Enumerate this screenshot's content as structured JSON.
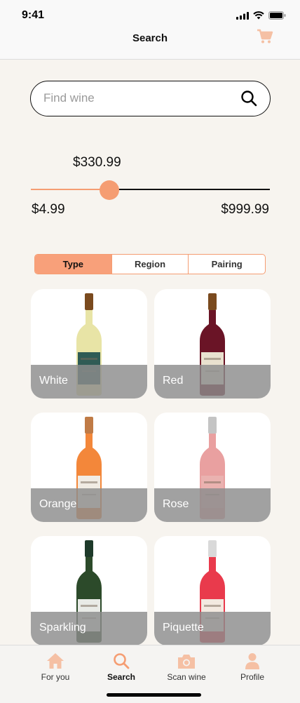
{
  "status": {
    "time": "9:41"
  },
  "nav": {
    "title": "Search"
  },
  "search": {
    "placeholder": "Find wine",
    "value": ""
  },
  "price": {
    "current": "$330.99",
    "min": "$4.99",
    "max": "$999.99",
    "fraction": 0.327
  },
  "filters": {
    "tabs": [
      "Type",
      "Region",
      "Pairing"
    ],
    "active": "Type"
  },
  "wine_types": [
    {
      "label": "White",
      "color": "#e8e4a6",
      "label_color": "#2f5b55",
      "cap": "#7a4a1e"
    },
    {
      "label": "Red",
      "color": "#6a1426",
      "label_color": "#e9e1cf",
      "cap": "#7a4a1e"
    },
    {
      "label": "Orange",
      "color": "#f3873a",
      "label_color": "#f1ece4",
      "cap": "#c07b46"
    },
    {
      "label": "Rose",
      "color": "#e9a0a0",
      "label_color": "#eab2b0",
      "cap": "#c4c4c4"
    },
    {
      "label": "Sparkling",
      "color": "#2c4a2a",
      "label_color": "#e9ebe7",
      "cap": "#1e3a2a"
    },
    {
      "label": "Piquette",
      "color": "#e93a4c",
      "label_color": "#f3e9e0",
      "cap": "#d9d9d9"
    }
  ],
  "tabbar": [
    {
      "label": "For you",
      "icon": "house-icon",
      "active": false
    },
    {
      "label": "Search",
      "icon": "search-icon",
      "active": true
    },
    {
      "label": "Scan wine",
      "icon": "camera-icon",
      "active": false
    },
    {
      "label": "Profile",
      "icon": "person-icon",
      "active": false
    }
  ],
  "colors": {
    "accent": "#f59d72",
    "background": "#f7f4ef"
  }
}
